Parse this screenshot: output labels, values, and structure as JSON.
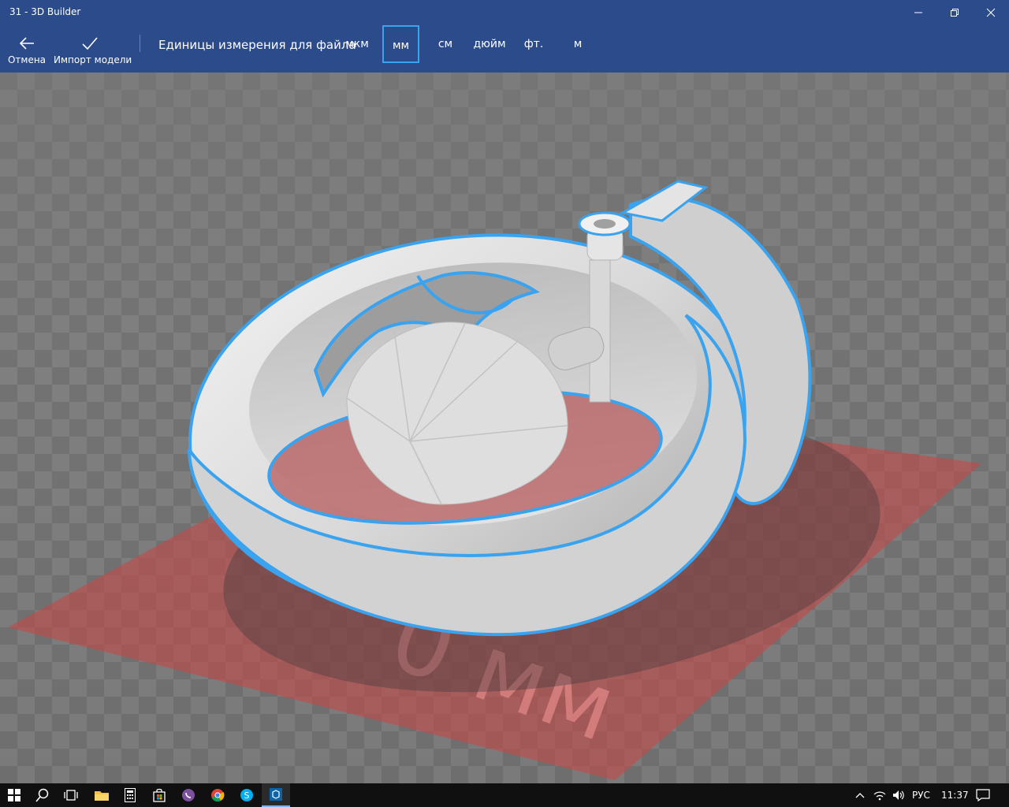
{
  "window": {
    "title": "31 - 3D Builder",
    "controls": [
      "minimize-icon",
      "restore-icon",
      "close-icon"
    ]
  },
  "toolbar": {
    "cancel_label": "Отмена",
    "import_label": "Импорт модели",
    "units_label": "Единицы измерения для файла",
    "units": [
      "мкм",
      "мм",
      "см",
      "дюйм",
      "фт.",
      "м"
    ],
    "selected_unit": "мм"
  },
  "viewport": {
    "plate_label": "0 мм",
    "accent_color": "#3aa3f0",
    "plate_color": "#c44a4a"
  },
  "taskbar": {
    "icons": [
      "windows-start-icon",
      "search-icon",
      "task-view-icon",
      "file-explorer-icon",
      "calculator-icon",
      "store-icon",
      "viber-icon",
      "chrome-icon",
      "skype-icon",
      "3d-builder-icon"
    ],
    "language": "РУС",
    "time": "11:37"
  }
}
